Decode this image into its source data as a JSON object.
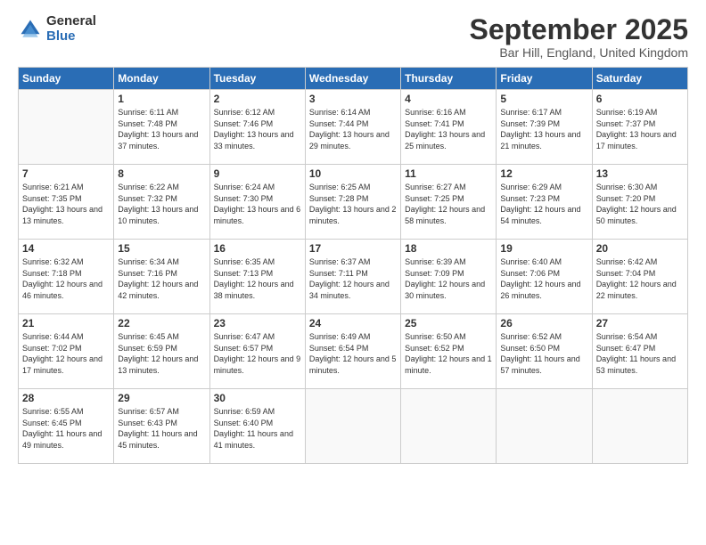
{
  "logo": {
    "general": "General",
    "blue": "Blue"
  },
  "header": {
    "month": "September 2025",
    "location": "Bar Hill, England, United Kingdom"
  },
  "days": [
    "Sunday",
    "Monday",
    "Tuesday",
    "Wednesday",
    "Thursday",
    "Friday",
    "Saturday"
  ],
  "weeks": [
    [
      {
        "day": "",
        "sunrise": "",
        "sunset": "",
        "daylight": ""
      },
      {
        "day": "1",
        "sunrise": "Sunrise: 6:11 AM",
        "sunset": "Sunset: 7:48 PM",
        "daylight": "Daylight: 13 hours and 37 minutes."
      },
      {
        "day": "2",
        "sunrise": "Sunrise: 6:12 AM",
        "sunset": "Sunset: 7:46 PM",
        "daylight": "Daylight: 13 hours and 33 minutes."
      },
      {
        "day": "3",
        "sunrise": "Sunrise: 6:14 AM",
        "sunset": "Sunset: 7:44 PM",
        "daylight": "Daylight: 13 hours and 29 minutes."
      },
      {
        "day": "4",
        "sunrise": "Sunrise: 6:16 AM",
        "sunset": "Sunset: 7:41 PM",
        "daylight": "Daylight: 13 hours and 25 minutes."
      },
      {
        "day": "5",
        "sunrise": "Sunrise: 6:17 AM",
        "sunset": "Sunset: 7:39 PM",
        "daylight": "Daylight: 13 hours and 21 minutes."
      },
      {
        "day": "6",
        "sunrise": "Sunrise: 6:19 AM",
        "sunset": "Sunset: 7:37 PM",
        "daylight": "Daylight: 13 hours and 17 minutes."
      }
    ],
    [
      {
        "day": "7",
        "sunrise": "Sunrise: 6:21 AM",
        "sunset": "Sunset: 7:35 PM",
        "daylight": "Daylight: 13 hours and 13 minutes."
      },
      {
        "day": "8",
        "sunrise": "Sunrise: 6:22 AM",
        "sunset": "Sunset: 7:32 PM",
        "daylight": "Daylight: 13 hours and 10 minutes."
      },
      {
        "day": "9",
        "sunrise": "Sunrise: 6:24 AM",
        "sunset": "Sunset: 7:30 PM",
        "daylight": "Daylight: 13 hours and 6 minutes."
      },
      {
        "day": "10",
        "sunrise": "Sunrise: 6:25 AM",
        "sunset": "Sunset: 7:28 PM",
        "daylight": "Daylight: 13 hours and 2 minutes."
      },
      {
        "day": "11",
        "sunrise": "Sunrise: 6:27 AM",
        "sunset": "Sunset: 7:25 PM",
        "daylight": "Daylight: 12 hours and 58 minutes."
      },
      {
        "day": "12",
        "sunrise": "Sunrise: 6:29 AM",
        "sunset": "Sunset: 7:23 PM",
        "daylight": "Daylight: 12 hours and 54 minutes."
      },
      {
        "day": "13",
        "sunrise": "Sunrise: 6:30 AM",
        "sunset": "Sunset: 7:20 PM",
        "daylight": "Daylight: 12 hours and 50 minutes."
      }
    ],
    [
      {
        "day": "14",
        "sunrise": "Sunrise: 6:32 AM",
        "sunset": "Sunset: 7:18 PM",
        "daylight": "Daylight: 12 hours and 46 minutes."
      },
      {
        "day": "15",
        "sunrise": "Sunrise: 6:34 AM",
        "sunset": "Sunset: 7:16 PM",
        "daylight": "Daylight: 12 hours and 42 minutes."
      },
      {
        "day": "16",
        "sunrise": "Sunrise: 6:35 AM",
        "sunset": "Sunset: 7:13 PM",
        "daylight": "Daylight: 12 hours and 38 minutes."
      },
      {
        "day": "17",
        "sunrise": "Sunrise: 6:37 AM",
        "sunset": "Sunset: 7:11 PM",
        "daylight": "Daylight: 12 hours and 34 minutes."
      },
      {
        "day": "18",
        "sunrise": "Sunrise: 6:39 AM",
        "sunset": "Sunset: 7:09 PM",
        "daylight": "Daylight: 12 hours and 30 minutes."
      },
      {
        "day": "19",
        "sunrise": "Sunrise: 6:40 AM",
        "sunset": "Sunset: 7:06 PM",
        "daylight": "Daylight: 12 hours and 26 minutes."
      },
      {
        "day": "20",
        "sunrise": "Sunrise: 6:42 AM",
        "sunset": "Sunset: 7:04 PM",
        "daylight": "Daylight: 12 hours and 22 minutes."
      }
    ],
    [
      {
        "day": "21",
        "sunrise": "Sunrise: 6:44 AM",
        "sunset": "Sunset: 7:02 PM",
        "daylight": "Daylight: 12 hours and 17 minutes."
      },
      {
        "day": "22",
        "sunrise": "Sunrise: 6:45 AM",
        "sunset": "Sunset: 6:59 PM",
        "daylight": "Daylight: 12 hours and 13 minutes."
      },
      {
        "day": "23",
        "sunrise": "Sunrise: 6:47 AM",
        "sunset": "Sunset: 6:57 PM",
        "daylight": "Daylight: 12 hours and 9 minutes."
      },
      {
        "day": "24",
        "sunrise": "Sunrise: 6:49 AM",
        "sunset": "Sunset: 6:54 PM",
        "daylight": "Daylight: 12 hours and 5 minutes."
      },
      {
        "day": "25",
        "sunrise": "Sunrise: 6:50 AM",
        "sunset": "Sunset: 6:52 PM",
        "daylight": "Daylight: 12 hours and 1 minute."
      },
      {
        "day": "26",
        "sunrise": "Sunrise: 6:52 AM",
        "sunset": "Sunset: 6:50 PM",
        "daylight": "Daylight: 11 hours and 57 minutes."
      },
      {
        "day": "27",
        "sunrise": "Sunrise: 6:54 AM",
        "sunset": "Sunset: 6:47 PM",
        "daylight": "Daylight: 11 hours and 53 minutes."
      }
    ],
    [
      {
        "day": "28",
        "sunrise": "Sunrise: 6:55 AM",
        "sunset": "Sunset: 6:45 PM",
        "daylight": "Daylight: 11 hours and 49 minutes."
      },
      {
        "day": "29",
        "sunrise": "Sunrise: 6:57 AM",
        "sunset": "Sunset: 6:43 PM",
        "daylight": "Daylight: 11 hours and 45 minutes."
      },
      {
        "day": "30",
        "sunrise": "Sunrise: 6:59 AM",
        "sunset": "Sunset: 6:40 PM",
        "daylight": "Daylight: 11 hours and 41 minutes."
      },
      {
        "day": "",
        "sunrise": "",
        "sunset": "",
        "daylight": ""
      },
      {
        "day": "",
        "sunrise": "",
        "sunset": "",
        "daylight": ""
      },
      {
        "day": "",
        "sunrise": "",
        "sunset": "",
        "daylight": ""
      },
      {
        "day": "",
        "sunrise": "",
        "sunset": "",
        "daylight": ""
      }
    ]
  ]
}
